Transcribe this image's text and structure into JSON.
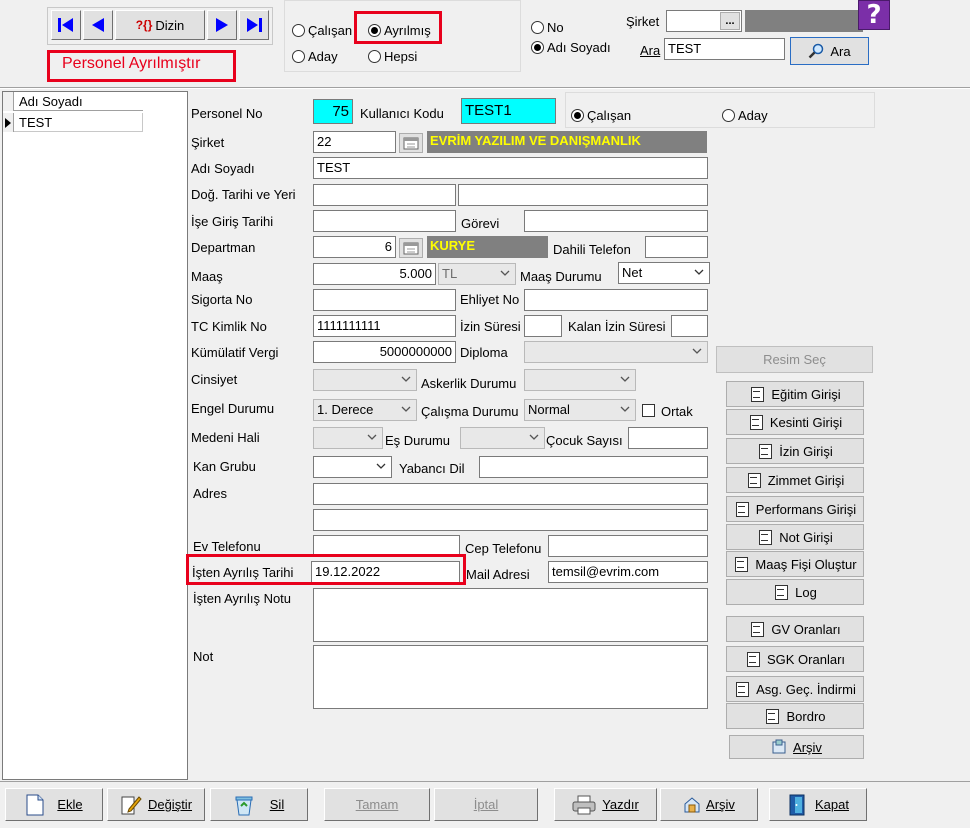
{
  "nav": {
    "dizin_label": "Dizin",
    "dizin_prefix": "?{}"
  },
  "banner": "Personel Ayrılmıştır",
  "filter": {
    "calisan": "Çalışan",
    "ayrilmis": "Ayrılmış",
    "aday": "Aday",
    "hepsi": "Hepsi",
    "selected": "Ayrılmış"
  },
  "search": {
    "no_label": "No",
    "adisoyadi_label": "Adı Soyadı",
    "sirket_label": "Şirket",
    "sirket_button": "...",
    "ara_label": "Ara",
    "ara_value": "TEST",
    "ara_button": "Ara"
  },
  "grid": {
    "header": "Adı Soyadı",
    "rows": [
      "TEST"
    ]
  },
  "form": {
    "personel_no_label": "Personel No",
    "personel_no": "75",
    "kullanici_kodu_label": "Kullanıcı Kodu",
    "kullanici_kodu": "TEST1",
    "type_calisan": "Çalışan",
    "type_aday": "Aday",
    "sirket_label": "Şirket",
    "sirket_no": "22",
    "sirket_name": "EVRİM YAZILIM VE DANIŞMANLIK",
    "adi_soyadi_label": "Adı Soyadı",
    "adi_soyadi": "TEST",
    "dogum_label": "Doğ. Tarihi ve Yeri",
    "ise_giris_label": "İşe Giriş Tarihi",
    "gorevi_label": "Görevi",
    "departman_label": "Departman",
    "departman_no": "6",
    "departman_name": "KURYE",
    "dahili_label": "Dahili Telefon",
    "maas_label": "Maaş",
    "maas": "5.000",
    "maas_currency": "TL",
    "maas_durumu_label": "Maaş Durumu",
    "maas_durumu": "Net",
    "sigorta_label": "Sigorta No",
    "ehliyet_label": "Ehliyet No",
    "tc_label": "TC Kimlik No",
    "tc": "1111111111",
    "izin_label": "İzin Süresi",
    "kalan_izin_label": "Kalan İzin Süresi",
    "kumulatif_label": "Kümülatif Vergi",
    "kumulatif": "5000000000",
    "diploma_label": "Diploma",
    "cinsiyet_label": "Cinsiyet",
    "askerlik_label": "Askerlik Durumu",
    "engel_label": "Engel Durumu",
    "engel": "1. Derece",
    "calisma_label": "Çalışma Durumu",
    "calisma": "Normal",
    "ortak_label": "Ortak",
    "medeni_label": "Medeni Hali",
    "es_label": "Eş Durumu",
    "cocuk_label": "Çocuk Sayısı",
    "kan_label": "Kan Grubu",
    "yabanci_label": "Yabancı Dil",
    "adres_label": "Adres",
    "ev_tel_label": "Ev Telefonu",
    "cep_label": "Cep Telefonu",
    "isten_ayrilis_label": "İşten Ayrılış Tarihi",
    "isten_ayrilis": "19.12.2022",
    "mail_label": "Mail Adresi",
    "mail": "temsil@evrim.com",
    "ayrilis_notu_label": "İşten Ayrılış Notu",
    "not_label": "Not"
  },
  "side": {
    "resim_sec": "Resim Seç",
    "buttons": [
      "Eğitim Girişi",
      "Kesinti Girişi",
      "İzin Girişi",
      "Zimmet Girişi",
      "Performans Girişi",
      "Not Girişi",
      "Maaş Fişi Oluştur",
      "Log"
    ],
    "buttons2": [
      "GV Oranları",
      "SGK Oranları",
      "Asg. Geç. İndirmi",
      "Bordro"
    ],
    "arsiv": "Arşiv"
  },
  "bottom": {
    "ekle": "Ekle",
    "degistir": "Değiştir",
    "sil": "Sil",
    "tamam": "Tamam",
    "iptal": "İptal",
    "yazdir": "Yazdır",
    "arsiv": "Arşiv",
    "kapat": "Kapat"
  },
  "colors": {
    "accent_red": "#e8001c",
    "cyan_field": "#00ffff",
    "dark_label_bg": "#808080",
    "yellow_text": "#ffff00",
    "nav_blue": "#0000ff"
  }
}
